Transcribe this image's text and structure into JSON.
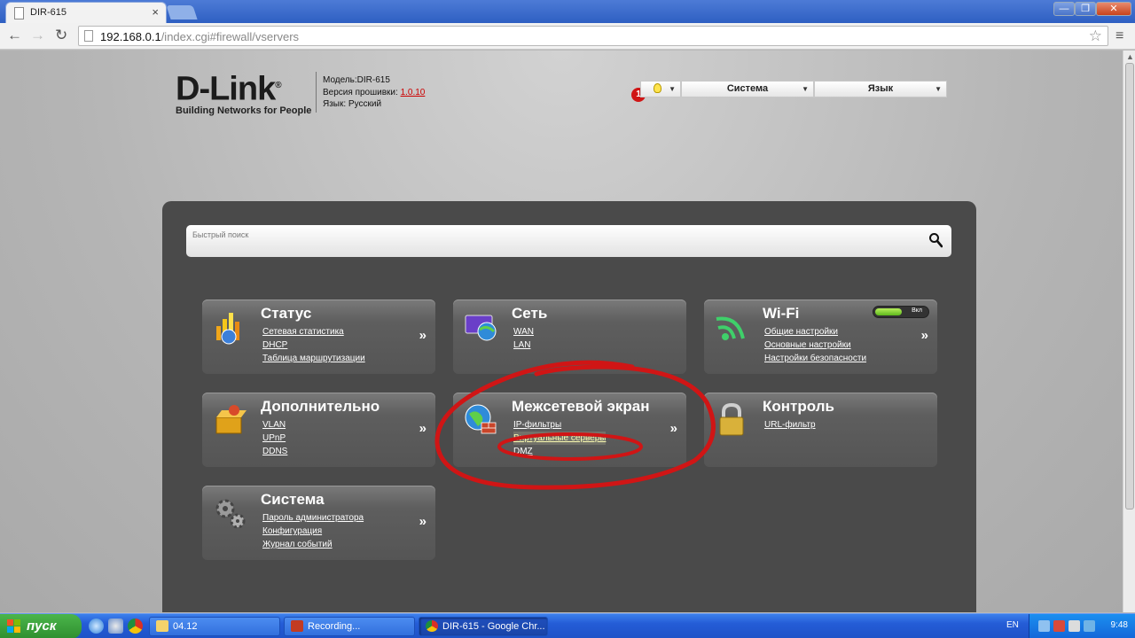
{
  "browser": {
    "tab_title": "DIR-615",
    "tab_close": "×",
    "url_host": "192.168.0.1",
    "url_path": "/index.cgi#firewall/vservers",
    "win_min": "—",
    "win_max": "❐",
    "win_close": "✕",
    "back": "←",
    "forward": "→",
    "reload": "↻",
    "star": "☆",
    "menu": "≡"
  },
  "header": {
    "logo": "D-Link",
    "logo_reg": "®",
    "tagline": "Building Networks for People",
    "model": "Модель:DIR-615",
    "firmware_label": "Версия прошивки:",
    "firmware_version": "1.0.10",
    "language": "Язык: Русский",
    "notification_count": "1",
    "menu_system": "Система",
    "menu_language": "Язык",
    "arrow": "▼"
  },
  "search": {
    "placeholder": "Быстрый поиск"
  },
  "cards": {
    "status": {
      "title": "Статус",
      "links": [
        "Сетевая статистика",
        "DHCP",
        "Таблица маршрутизации"
      ]
    },
    "network": {
      "title": "Сеть",
      "links": [
        "WAN",
        "LAN"
      ]
    },
    "wifi": {
      "title": "Wi-Fi",
      "toggle_label": "Вкл",
      "links": [
        "Общие настройки",
        "Основные настройки",
        "Настройки безопасности"
      ]
    },
    "advanced": {
      "title": "Дополнительно",
      "links": [
        "VLAN",
        "UPnP",
        "DDNS"
      ]
    },
    "firewall": {
      "title": "Межсетевой экран",
      "links": [
        "IP-фильтры",
        "Виртуальные серверы",
        "DMZ"
      ]
    },
    "control": {
      "title": "Контроль",
      "links": [
        "URL-фильтр"
      ]
    },
    "system": {
      "title": "Система",
      "links": [
        "Пароль администратора",
        "Конфигурация",
        "Журнал событий"
      ]
    },
    "more": "»"
  },
  "colors": {
    "panel": "#4a4a4a",
    "annotation": "#d01515",
    "firmware": "#cc0000"
  },
  "taskbar": {
    "start": "пуск",
    "tasks": [
      "04.12",
      "Recording...",
      "DIR-615 - Google Chr..."
    ],
    "language": "EN",
    "clock": "9:48"
  }
}
